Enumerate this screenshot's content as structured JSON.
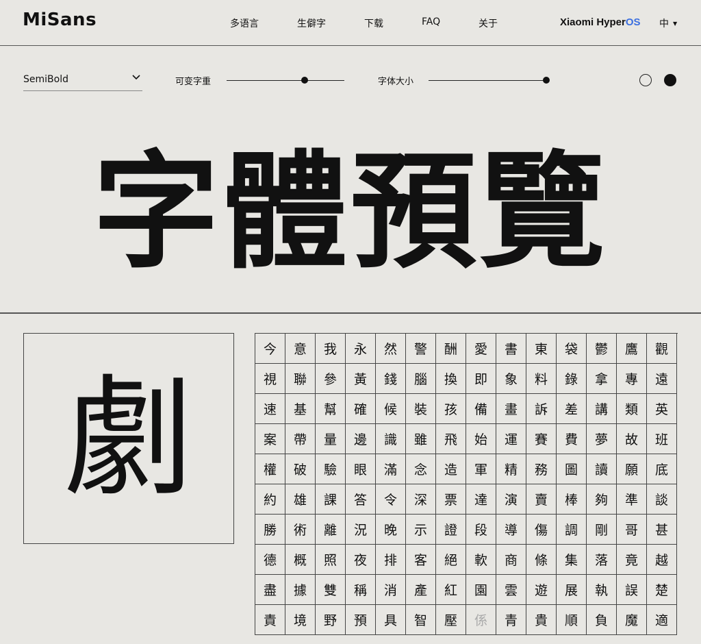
{
  "header": {
    "logo": "MiSans",
    "nav": [
      "多语言",
      "生僻字",
      "下载",
      "FAQ",
      "关于"
    ],
    "brand_main": "Xiaomi Hyper",
    "brand_accent": "OS",
    "lang": "中",
    "accent_color": "#3b6fe0"
  },
  "controls": {
    "weight_value": "SemiBold",
    "variable_weight_label": "可变字重",
    "font_size_label": "字体大小",
    "variable_weight_level": 0.66,
    "font_size_level": 1.0
  },
  "preview_text": "字體預覽",
  "selected_char": "劇",
  "grid_rows": [
    [
      "今",
      "意",
      "我",
      "永",
      "然",
      "警",
      "酬",
      "愛",
      "書",
      "東",
      "袋",
      "鬱",
      "鷹",
      "觀"
    ],
    [
      "視",
      "聯",
      "參",
      "黃",
      "錢",
      "腦",
      "換",
      "即",
      "象",
      "料",
      "錄",
      "拿",
      "專",
      "遠"
    ],
    [
      "速",
      "基",
      "幫",
      "確",
      "候",
      "裝",
      "孩",
      "備",
      "畫",
      "訴",
      "差",
      "講",
      "類",
      "英"
    ],
    [
      "案",
      "帶",
      "量",
      "邊",
      "識",
      "雖",
      "飛",
      "始",
      "運",
      "賽",
      "費",
      "夢",
      "故",
      "班"
    ],
    [
      "權",
      "破",
      "驗",
      "眼",
      "滿",
      "念",
      "造",
      "軍",
      "精",
      "務",
      "圖",
      "讀",
      "願",
      "底"
    ],
    [
      "約",
      "雄",
      "課",
      "答",
      "令",
      "深",
      "票",
      "達",
      "演",
      "賣",
      "棒",
      "夠",
      "準",
      "談"
    ],
    [
      "勝",
      "術",
      "離",
      "況",
      "晚",
      "示",
      "證",
      "段",
      "導",
      "傷",
      "調",
      "剛",
      "哥",
      "甚"
    ],
    [
      "德",
      "概",
      "照",
      "夜",
      "排",
      "客",
      "絕",
      "軟",
      "商",
      "條",
      "集",
      "落",
      "竟",
      "越"
    ],
    [
      "盡",
      "據",
      "雙",
      "稱",
      "消",
      "產",
      "紅",
      "園",
      "雲",
      "遊",
      "展",
      "執",
      "誤",
      "楚"
    ],
    [
      "責",
      "境",
      "野",
      "預",
      "具",
      "智",
      "壓",
      "係",
      "青",
      "貴",
      "順",
      "負",
      "魔",
      "適"
    ]
  ],
  "dim_cell": "係"
}
